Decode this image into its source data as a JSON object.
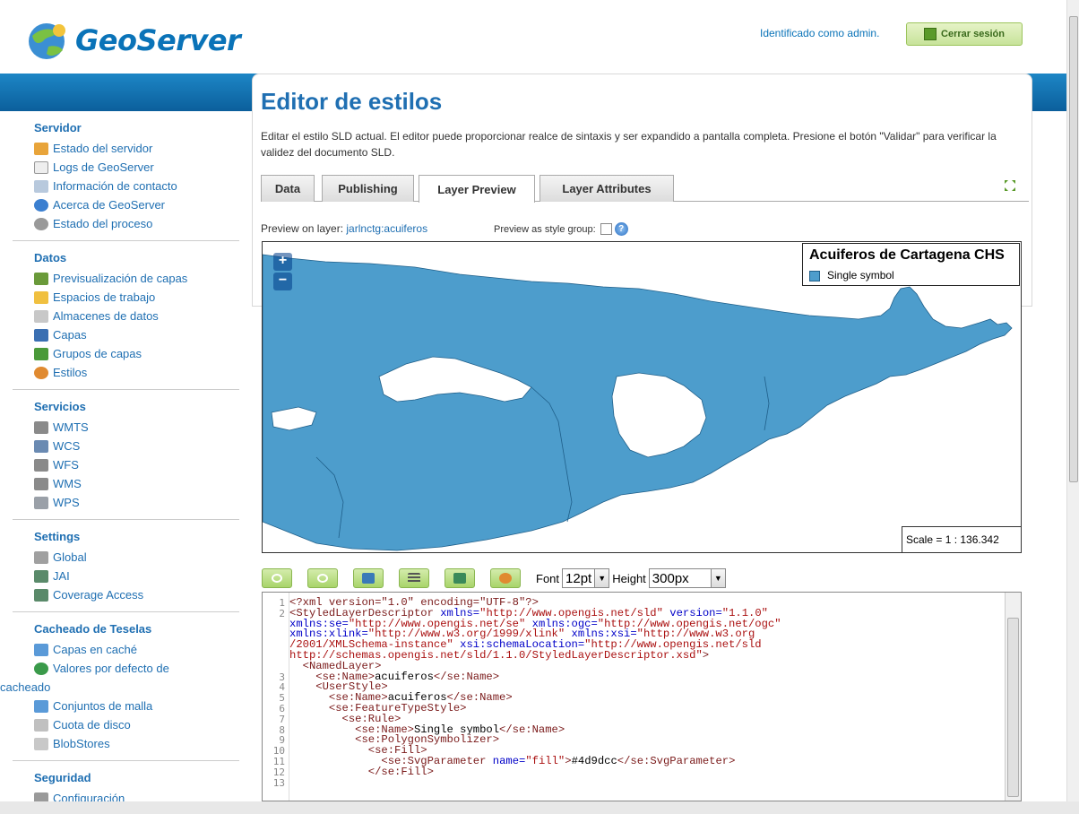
{
  "header": {
    "brand": "GeoServer",
    "logged_in_text": "Identificado como admin.",
    "logout_label": "Cerrar sesión"
  },
  "sidebar": {
    "sections": [
      {
        "title": "Servidor",
        "items": [
          "Estado del servidor",
          "Logs de GeoServer",
          "Información de contacto",
          "Acerca de GeoServer",
          "Estado del proceso"
        ]
      },
      {
        "title": "Datos",
        "items": [
          "Previsualización de capas",
          "Espacios de trabajo",
          "Almacenes de datos",
          "Capas",
          "Grupos de capas",
          "Estilos"
        ]
      },
      {
        "title": "Servicios",
        "items": [
          "WMTS",
          "WCS",
          "WFS",
          "WMS",
          "WPS"
        ]
      },
      {
        "title": "Settings",
        "items": [
          "Global",
          "JAI",
          "Coverage Access"
        ]
      },
      {
        "title": "Cacheado de Teselas",
        "items": [
          "Capas en caché",
          "Valores por defecto de",
          "cacheado",
          "Conjuntos de malla",
          "Cuota de disco",
          "BlobStores"
        ]
      },
      {
        "title": "Seguridad",
        "items": [
          "Configuración"
        ]
      }
    ]
  },
  "main": {
    "title": "Editor de estilos",
    "description": "Editar el estilo SLD actual. El editor puede proporcionar realce de sintaxis y ser expandido a pantalla completa. Presione el botón \"Validar\" para verificar la validez del documento SLD.",
    "tabs": [
      "Data",
      "Publishing",
      "Layer Preview",
      "Layer Attributes"
    ],
    "active_tab": "Layer Preview",
    "preview_on_layer_label": "Preview on layer:",
    "preview_layer_link": "jarlnctg:acuiferos",
    "preview_group_label": "Preview as style group:"
  },
  "map": {
    "zoom_in": "+",
    "zoom_out": "−",
    "legend_title": "Acuiferos de Cartagena CHS",
    "legend_item": "Single symbol",
    "fill_color": "#4d9dcc",
    "scale_text": "Scale = 1 : 136.342"
  },
  "toolbar": {
    "font_label": "Font",
    "font_value": "12pt",
    "height_label": "Height",
    "height_value": "300px"
  },
  "colors": {
    "accent": "#1f6fb2",
    "band": "#0b5f9c",
    "polygon": "#4d9dcc"
  }
}
